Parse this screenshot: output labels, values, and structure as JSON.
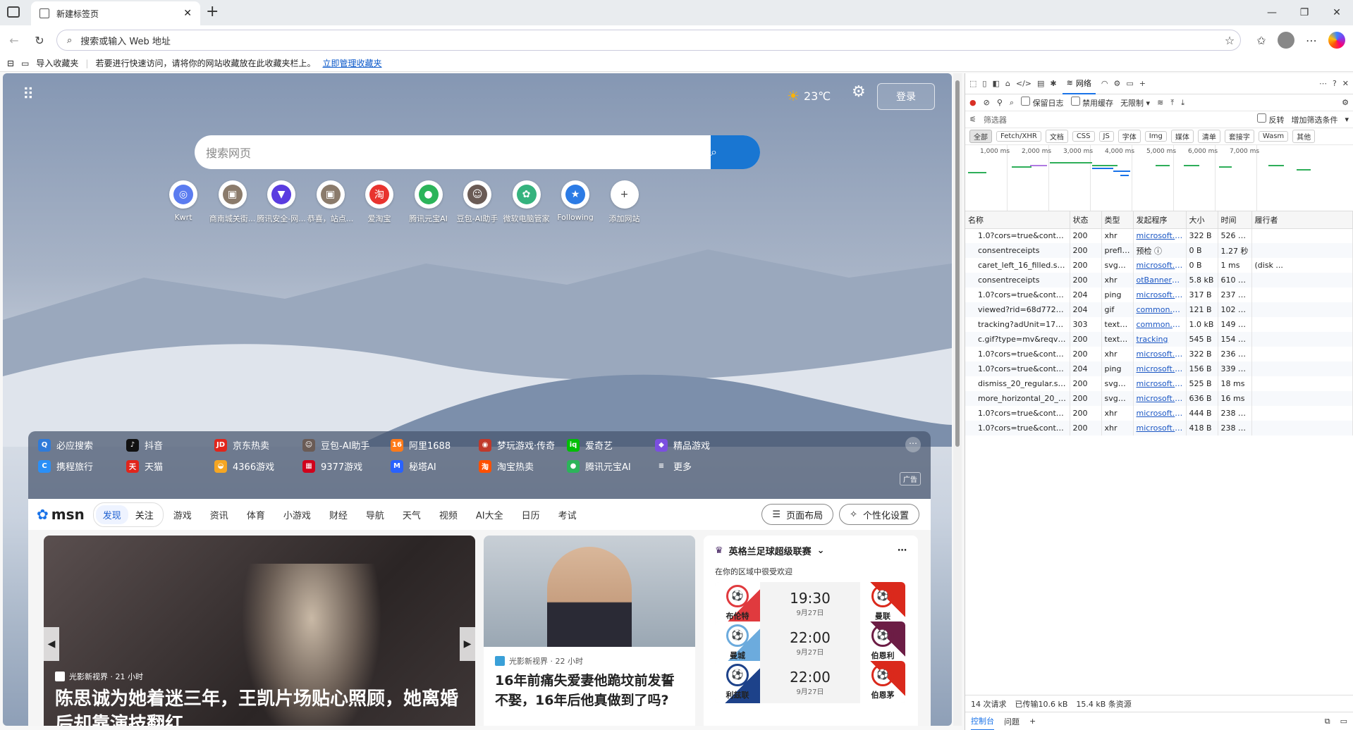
{
  "browser": {
    "tab_title": "新建标签页",
    "address_placeholder": "搜索或输入 Web 地址",
    "favbar": {
      "import": "导入收藏夹",
      "hint": "若要进行快速访问，请将你的网站收藏放在此收藏夹栏上。",
      "manage_link": "立即管理收藏夹"
    }
  },
  "newtab": {
    "weather_temp": "23℃",
    "sign_in": "登录",
    "search_placeholder": "搜索网页",
    "quick_links": [
      {
        "label": "Kwrt",
        "color": "#5b7cf0",
        "glyph": "◎"
      },
      {
        "label": "商南城关街...",
        "color": "#8b7b6b",
        "glyph": "▣"
      },
      {
        "label": "腾讯安全-网...",
        "color": "#5a3ce0",
        "glyph": "▼"
      },
      {
        "label": "恭喜，站点...",
        "color": "#8b7b6b",
        "glyph": "▣"
      },
      {
        "label": "爱淘宝",
        "color": "#e8332e",
        "glyph": "淘"
      },
      {
        "label": "腾讯元宝AI",
        "color": "#2cb45a",
        "glyph": "●"
      },
      {
        "label": "豆包-AI助手",
        "color": "#6a5b55",
        "glyph": "☺"
      },
      {
        "label": "微软电脑管家",
        "color": "#35b37e",
        "glyph": "✿"
      },
      {
        "label": "Following",
        "color": "#2c7be5",
        "glyph": "★"
      },
      {
        "label": "添加网站",
        "color": "#ffffff",
        "glyph": "+"
      }
    ],
    "site_links": [
      {
        "label": "必应搜索",
        "color": "#2f7bd9",
        "glyph": "Q"
      },
      {
        "label": "抖音",
        "color": "#111111",
        "glyph": "♪"
      },
      {
        "label": "京东热卖",
        "color": "#e1251b",
        "glyph": "JD"
      },
      {
        "label": "豆包-AI助手",
        "color": "#6a5b55",
        "glyph": "☺"
      },
      {
        "label": "阿里1688",
        "color": "#ff7a1a",
        "glyph": "16"
      },
      {
        "label": "梦玩游戏·传奇",
        "color": "#c0392b",
        "glyph": "◉"
      },
      {
        "label": "爱奇艺",
        "color": "#00be06",
        "glyph": "iq"
      },
      {
        "label": "精品游戏",
        "color": "#7b4fe0",
        "glyph": "◆"
      },
      {
        "label": "携程旅行",
        "color": "#2a8ff7",
        "glyph": "C"
      },
      {
        "label": "天猫",
        "color": "#e1251b",
        "glyph": "天"
      },
      {
        "label": "4366游戏",
        "color": "#f5a623",
        "glyph": "◒"
      },
      {
        "label": "9377游戏",
        "color": "#d0021b",
        "glyph": "▦"
      },
      {
        "label": "秘塔AI",
        "color": "#2962ff",
        "glyph": "M"
      },
      {
        "label": "淘宝热卖",
        "color": "#ff5000",
        "glyph": "淘"
      },
      {
        "label": "腾讯元宝AI",
        "color": "#2cb45a",
        "glyph": "●"
      },
      {
        "label": "更多",
        "color": "transparent",
        "glyph": "≡"
      }
    ],
    "ad_label": "广告",
    "msn": {
      "logo": "msn",
      "tabs": [
        "发现",
        "关注"
      ],
      "nav": [
        "游戏",
        "资讯",
        "体育",
        "小游戏",
        "财经",
        "导航",
        "天气",
        "视频",
        "AI大全",
        "日历",
        "考试"
      ],
      "layout_btn": "页面布局",
      "personalize_btn": "个性化设置"
    },
    "hero": {
      "source": "光影新视界 · 21 小时",
      "title": "陈思诚为她着迷三年，王凯片场贴心照顾，她离婚后却靠演技翻红"
    },
    "card2": {
      "source": "光影新视界 · 22 小时",
      "title": "16年前痛失爱妻他跪坟前发誓不娶，16年后他真做到了吗?"
    },
    "sports": {
      "league": "英格兰足球超级联赛",
      "subtitle": "在你的区域中很受欢迎",
      "matches": [
        {
          "home": "布伦特",
          "away": "曼联",
          "time": "19:30",
          "date": "9月27日",
          "home_color": "#e03a3e",
          "away_color": "#da291c"
        },
        {
          "home": "曼城",
          "away": "伯恩利",
          "time": "22:00",
          "date": "9月27日",
          "home_color": "#6cabdd",
          "away_color": "#6c1d45"
        },
        {
          "home": "利兹联",
          "away": "伯恩茅",
          "time": "22:00",
          "date": "9月27日",
          "home_color": "#1d428a",
          "away_color": "#da291c"
        }
      ]
    }
  },
  "devtools": {
    "active_tab": "网络",
    "toolbar": {
      "preserve_log": "保留日志",
      "disable_cache": "禁用缓存",
      "throttle": "无限制"
    },
    "filter": {
      "placeholder": "筛选器",
      "invert": "反转",
      "more": "增加筛选条件"
    },
    "type_filters": [
      "全部",
      "Fetch/XHR",
      "文档",
      "CSS",
      "JS",
      "字体",
      "Img",
      "媒体",
      "清单",
      "套接字",
      "Wasm",
      "其他"
    ],
    "timeline_ticks": [
      "1,000 ms",
      "2,000 ms",
      "3,000 ms",
      "4,000 ms",
      "5,000 ms",
      "6,000 ms",
      "7,000 ms"
    ],
    "columns": [
      "名称",
      "状态",
      "类型",
      "发起程序",
      "大小",
      "时间",
      "履行者"
    ],
    "rows": [
      [
        "1.0?cors=true&content-t...",
        "200",
        "xhr",
        "microsoft.bfd5...",
        "322 B",
        "526 ms",
        ""
      ],
      [
        "consentreceipts",
        "200",
        "prefli...",
        "预检 ⓘ",
        "0 B",
        "1.27 秒",
        ""
      ],
      [
        "caret_left_16_filled.svg",
        "200",
        "svg+x...",
        "microsoft.bfd5...",
        "0 B",
        "1 ms",
        "(disk ..."
      ],
      [
        "consentreceipts",
        "200",
        "xhr",
        "otBannerSdk.js",
        "5.8 kB",
        "610 ms",
        ""
      ],
      [
        "1.0?cors=true&content-t...",
        "204",
        "ping",
        "microsoft.bfd5...",
        "317 B",
        "237 ms",
        ""
      ],
      [
        "viewed?rid=68d7725c5a...",
        "204",
        "gif",
        "common.780aa...",
        "121 B",
        "102 ms",
        ""
      ],
      [
        "tracking?adUnit=173276...",
        "303",
        "text/h...",
        "common.780aa...",
        "1.0 kB",
        "149 ms",
        ""
      ],
      [
        "c.gif?type=mv&reqver=...",
        "200",
        "text/p...",
        "tracking",
        "545 B",
        "154 ms",
        ""
      ],
      [
        "1.0?cors=true&content-t...",
        "200",
        "xhr",
        "microsoft.bfd5...",
        "322 B",
        "236 ms",
        ""
      ],
      [
        "1.0?cors=true&content-t...",
        "204",
        "ping",
        "microsoft.bfd5...",
        "156 B",
        "339 ms",
        ""
      ],
      [
        "dismiss_20_regular.svg",
        "200",
        "svg+x...",
        "microsoft.bfd5...",
        "525 B",
        "18 ms",
        ""
      ],
      [
        "more_horizontal_20_reg...",
        "200",
        "svg+x...",
        "microsoft.bfd5...",
        "636 B",
        "16 ms",
        ""
      ],
      [
        "1.0?cors=true&content-t...",
        "200",
        "xhr",
        "microsoft.bfd5...",
        "444 B",
        "238 ms",
        ""
      ],
      [
        "1.0?cors=true&content-t...",
        "200",
        "xhr",
        "microsoft.bfd5...",
        "418 B",
        "238 ms",
        ""
      ]
    ],
    "status": {
      "requests": "14 次请求",
      "transferred": "已传输10.6 kB",
      "resources": "15.4 kB 条资源"
    },
    "drawer": [
      "控制台",
      "问题"
    ]
  }
}
